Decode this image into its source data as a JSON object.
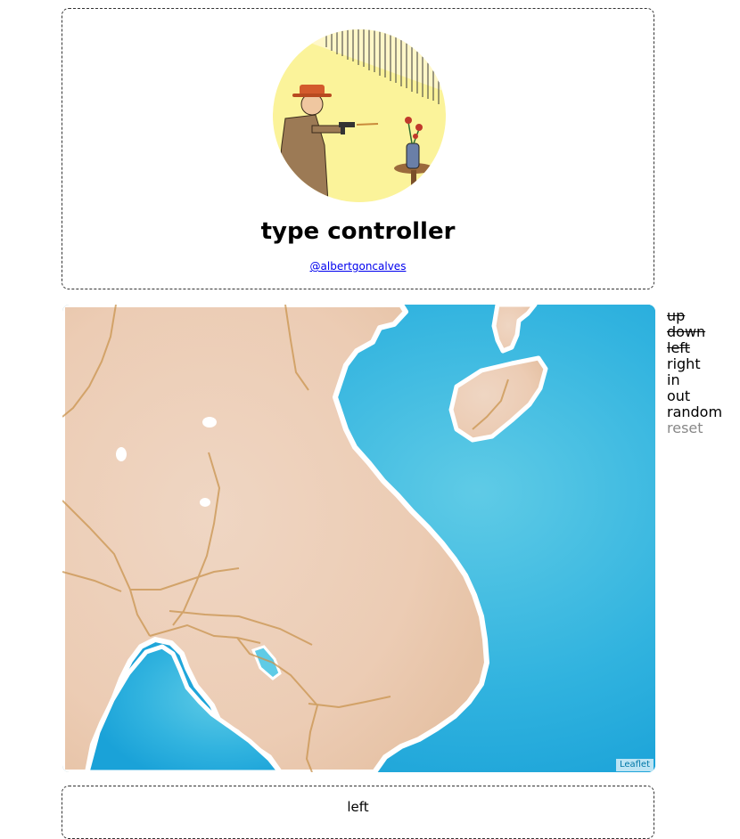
{
  "header": {
    "title": "type controller",
    "handle": "@albertgoncalves"
  },
  "map": {
    "attribution": "Leaflet"
  },
  "controls": [
    {
      "label": "up",
      "state": "disabled"
    },
    {
      "label": "down",
      "state": "disabled"
    },
    {
      "label": "left",
      "state": "disabled"
    },
    {
      "label": "right",
      "state": "enabled"
    },
    {
      "label": "in",
      "state": "enabled"
    },
    {
      "label": "out",
      "state": "enabled"
    },
    {
      "label": "random",
      "state": "enabled"
    },
    {
      "label": "reset",
      "state": "muted"
    }
  ],
  "status": {
    "last_command": "left"
  },
  "colors": {
    "water": "#2fb2de",
    "land": "#ecd2bf",
    "coast": "#ffffff",
    "roads": "#c9944f",
    "link": "#0000ee",
    "attribution": "#0078a8"
  }
}
